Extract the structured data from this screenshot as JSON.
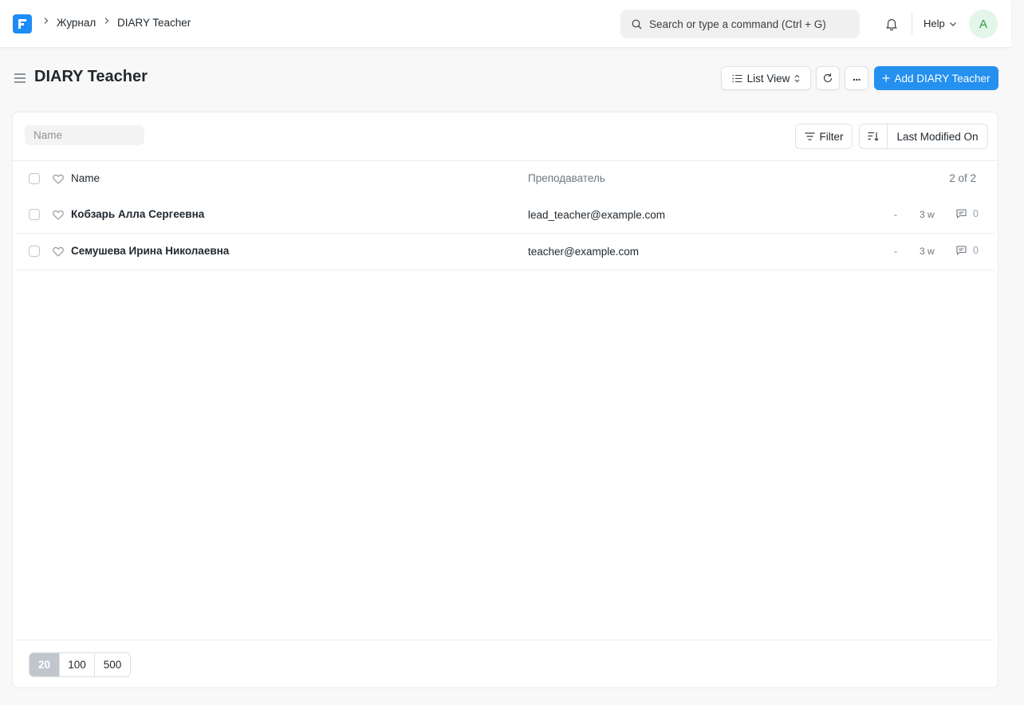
{
  "navbar": {
    "breadcrumbs": [
      "Журнал",
      "DIARY Teacher"
    ],
    "search_placeholder": "Search or type a command (Ctrl + G)",
    "help_label": "Help",
    "avatar_initial": "A"
  },
  "page": {
    "title": "DIARY Teacher",
    "view_label": "List View",
    "more_label": "...",
    "add_label": "Add DIARY Teacher"
  },
  "list": {
    "name_filter_placeholder": "Name",
    "filter_label": "Filter",
    "sort_label": "Last Modified On",
    "columns": {
      "name": "Name",
      "teacher": "Преподаватель",
      "count": "2 of 2"
    },
    "rows": [
      {
        "name": "Кобзарь Алла Сергеевна",
        "teacher": "lead_teacher@example.com",
        "status": "-",
        "modified": "3 w",
        "comments": "0"
      },
      {
        "name": "Семушева Ирина Николаевна",
        "teacher": "teacher@example.com",
        "status": "-",
        "modified": "3 w",
        "comments": "0"
      }
    ],
    "page_sizes": [
      "20",
      "100",
      "500"
    ]
  },
  "colors": {
    "brand": "#2490ef",
    "logo": "#1d8cf8",
    "avatar_bg": "#e4f5e9",
    "avatar_fg": "#2c9a4c"
  }
}
